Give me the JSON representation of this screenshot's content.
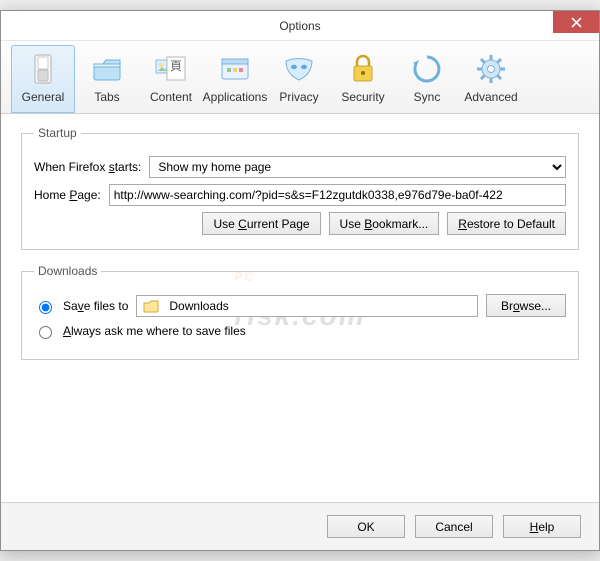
{
  "window": {
    "title": "Options"
  },
  "toolbar": [
    {
      "id": "general",
      "label": "General",
      "active": true
    },
    {
      "id": "tabs",
      "label": "Tabs",
      "active": false
    },
    {
      "id": "content",
      "label": "Content",
      "active": false
    },
    {
      "id": "applications",
      "label": "Applications",
      "active": false
    },
    {
      "id": "privacy",
      "label": "Privacy",
      "active": false
    },
    {
      "id": "security",
      "label": "Security",
      "active": false
    },
    {
      "id": "sync",
      "label": "Sync",
      "active": false
    },
    {
      "id": "advanced",
      "label": "Advanced",
      "active": false
    }
  ],
  "startup": {
    "legend": "Startup",
    "when_label_pre": "When Firefox ",
    "when_label_key": "s",
    "when_label_post": "tarts:",
    "when_value": "Show my home page",
    "home_label_pre": "Home ",
    "home_label_key": "P",
    "home_label_post": "age:",
    "home_value": "http://www-searching.com/?pid=s&s=F12zgutdk0338,e976d79e-ba0f-422",
    "btn_current_pre": "Use ",
    "btn_current_key": "C",
    "btn_current_post": "urrent Page",
    "btn_bookmark_pre": "Use ",
    "btn_bookmark_key": "B",
    "btn_bookmark_post": "ookmark...",
    "btn_restore_key": "R",
    "btn_restore_post": "estore to Default"
  },
  "downloads": {
    "legend": "Downloads",
    "save_label_pre": "Sa",
    "save_label_key": "v",
    "save_label_post": "e files to",
    "save_path": "Downloads",
    "browse_label_pre": "Br",
    "browse_label_key": "o",
    "browse_label_post": "wse...",
    "ask_label_key": "A",
    "ask_label_post": "lways ask me where to save files",
    "save_selected": true
  },
  "footer": {
    "ok": "OK",
    "cancel": "Cancel",
    "help_key": "H",
    "help_post": "elp"
  },
  "watermark": {
    "main": "PC",
    "sub": "risk.com"
  }
}
